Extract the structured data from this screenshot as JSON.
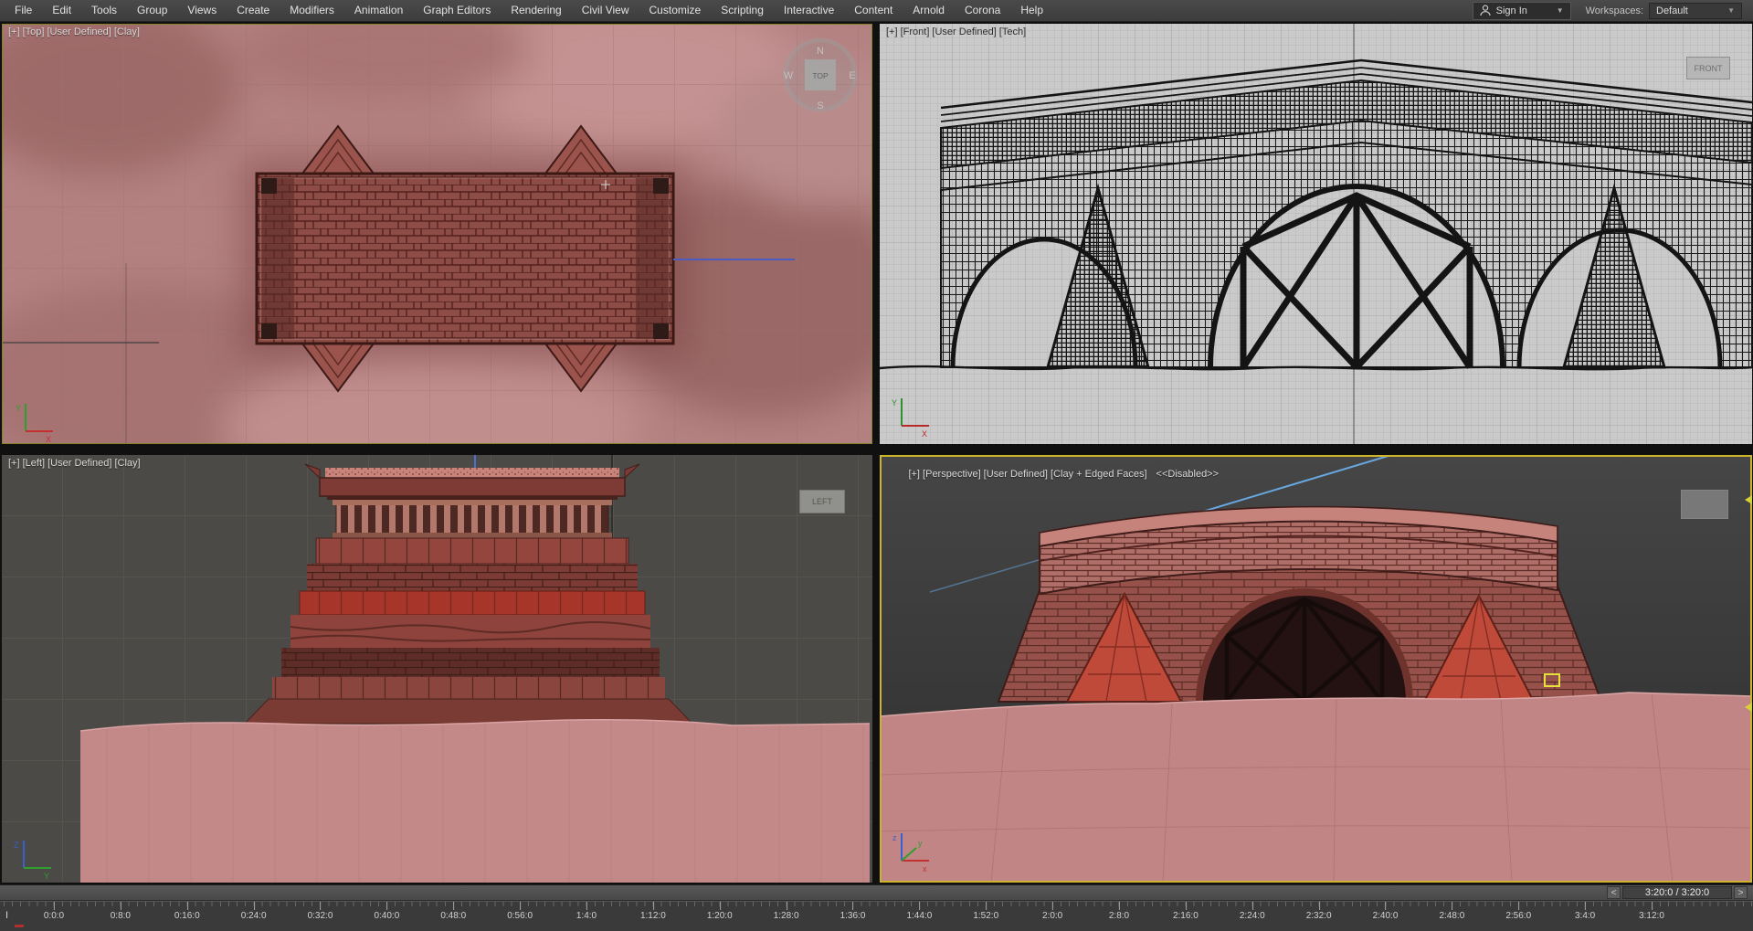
{
  "menu_bar": {
    "items": [
      "File",
      "Edit",
      "Tools",
      "Group",
      "Views",
      "Create",
      "Modifiers",
      "Animation",
      "Graph Editors",
      "Rendering",
      "Civil View",
      "Customize",
      "Scripting",
      "Interactive",
      "Content",
      "Arnold",
      "Corona",
      "Help"
    ],
    "sign_in": "Sign In",
    "sign_in_caret": "▼",
    "workspaces_label": "Workspaces:",
    "workspaces_value": "Default",
    "workspaces_caret": "▼"
  },
  "viewports": {
    "top_left": {
      "label": "[+] [Top] [User Defined] [Clay]",
      "viewcube": {
        "center": "TOP",
        "n": "N",
        "s": "S",
        "e": "E",
        "w": "W"
      },
      "axis": {
        "h": "X",
        "v": "Y"
      }
    },
    "top_right": {
      "label": "[+] [Front] [User Defined] [Tech]",
      "nav_box": "FRONT",
      "axis": {
        "h": "X",
        "v": "Y"
      }
    },
    "bottom_left": {
      "label": "[+] [Left] [User Defined] [Clay]",
      "nav_box": "LEFT",
      "axis": {
        "h": "Y",
        "v": "Z"
      }
    },
    "bottom_right": {
      "label": "[+] [Perspective] [User Defined] [Clay + Edged Faces]",
      "status": "<<Disabled>>",
      "axis": {
        "x": "x",
        "y": "y",
        "z": "z"
      }
    }
  },
  "timeline": {
    "ticks": [
      "0:0:0",
      "0:8:0",
      "0:16:0",
      "0:24:0",
      "0:32:0",
      "0:40:0",
      "0:48:0",
      "0:56:0",
      "1:4:0",
      "1:12:0",
      "1:20:0",
      "1:28:0",
      "1:36:0",
      "1:44:0",
      "1:52:0",
      "2:0:0",
      "2:8:0",
      "2:16:0",
      "2:24:0",
      "2:32:0",
      "2:40:0",
      "2:48:0",
      "2:56:0",
      "3:4:0",
      "3:12:0"
    ],
    "current_time": "3:20:0 / 3:20:0",
    "prev": "<",
    "next": ">",
    "trackbar_icon": "I"
  },
  "colors": {
    "active_viewport_border": "#cdb42c",
    "clay": "#b48181",
    "selection_yellow": "#e6e03a",
    "spline_blue": "#68a8e0"
  }
}
